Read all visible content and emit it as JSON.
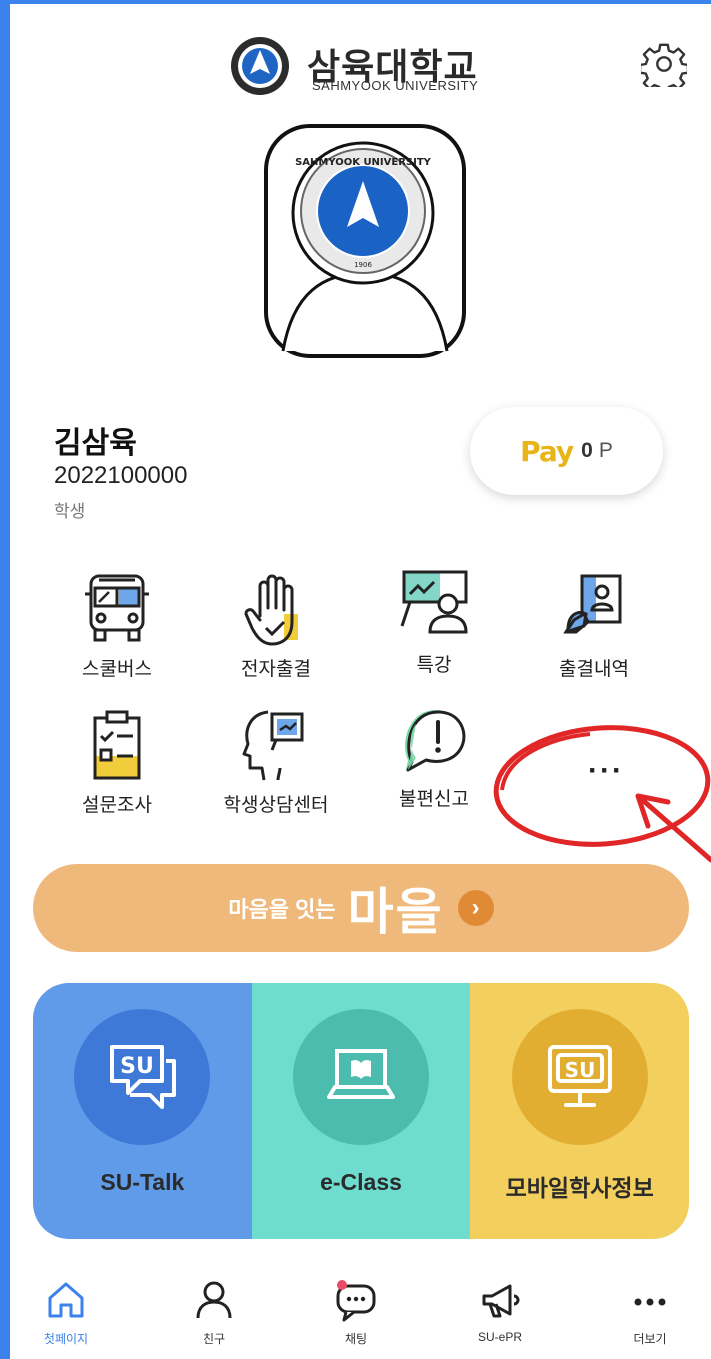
{
  "header": {
    "title": "삼육대학교",
    "subtitle": "SAHMYOOK UNIVERSITY",
    "settings_icon": "gear-icon"
  },
  "profile": {
    "name": "김삼육",
    "student_id": "2022100000",
    "role": "학생"
  },
  "pay": {
    "logo": "Pay",
    "amount": "0",
    "unit": "P"
  },
  "menu": {
    "items": [
      {
        "label": "스쿨버스",
        "icon": "bus-icon"
      },
      {
        "label": "전자출결",
        "icon": "hand-check-icon"
      },
      {
        "label": "특강",
        "icon": "lecture-icon"
      },
      {
        "label": "출결내역",
        "icon": "attendance-card-icon"
      },
      {
        "label": "설문조사",
        "icon": "survey-clipboard-icon"
      },
      {
        "label": "학생상담센터",
        "icon": "counseling-head-icon"
      },
      {
        "label": "불편신고",
        "icon": "report-exclamation-icon"
      }
    ],
    "more": "···"
  },
  "banner": {
    "prefix": "마음을 잇는",
    "title": "마을",
    "arrow": "›"
  },
  "tiles": [
    {
      "label": "SU-Talk",
      "bg": "#5f9be9",
      "circle": "#3f79d8",
      "icon": "su-talk-icon"
    },
    {
      "label": "e-Class",
      "bg": "#6fdcd0",
      "circle": "#4bbcae",
      "icon": "laptop-book-icon"
    },
    {
      "label": "모바일학사정보",
      "bg": "#f3cf5e",
      "circle": "#e1ae31",
      "icon": "su-monitor-icon"
    }
  ],
  "bottom_nav": [
    {
      "label": "첫페이지",
      "icon": "home-icon",
      "active": true
    },
    {
      "label": "친구",
      "icon": "person-icon"
    },
    {
      "label": "채팅",
      "icon": "chat-icon"
    },
    {
      "label": "SU-ePR",
      "icon": "megaphone-icon"
    },
    {
      "label": "더보기",
      "icon": "more-dots-icon"
    }
  ],
  "colors": {
    "frame": "#3b82ec",
    "pay_accent": "#e8b417",
    "banner": "#eeb97a",
    "annotation": "#e02626"
  }
}
